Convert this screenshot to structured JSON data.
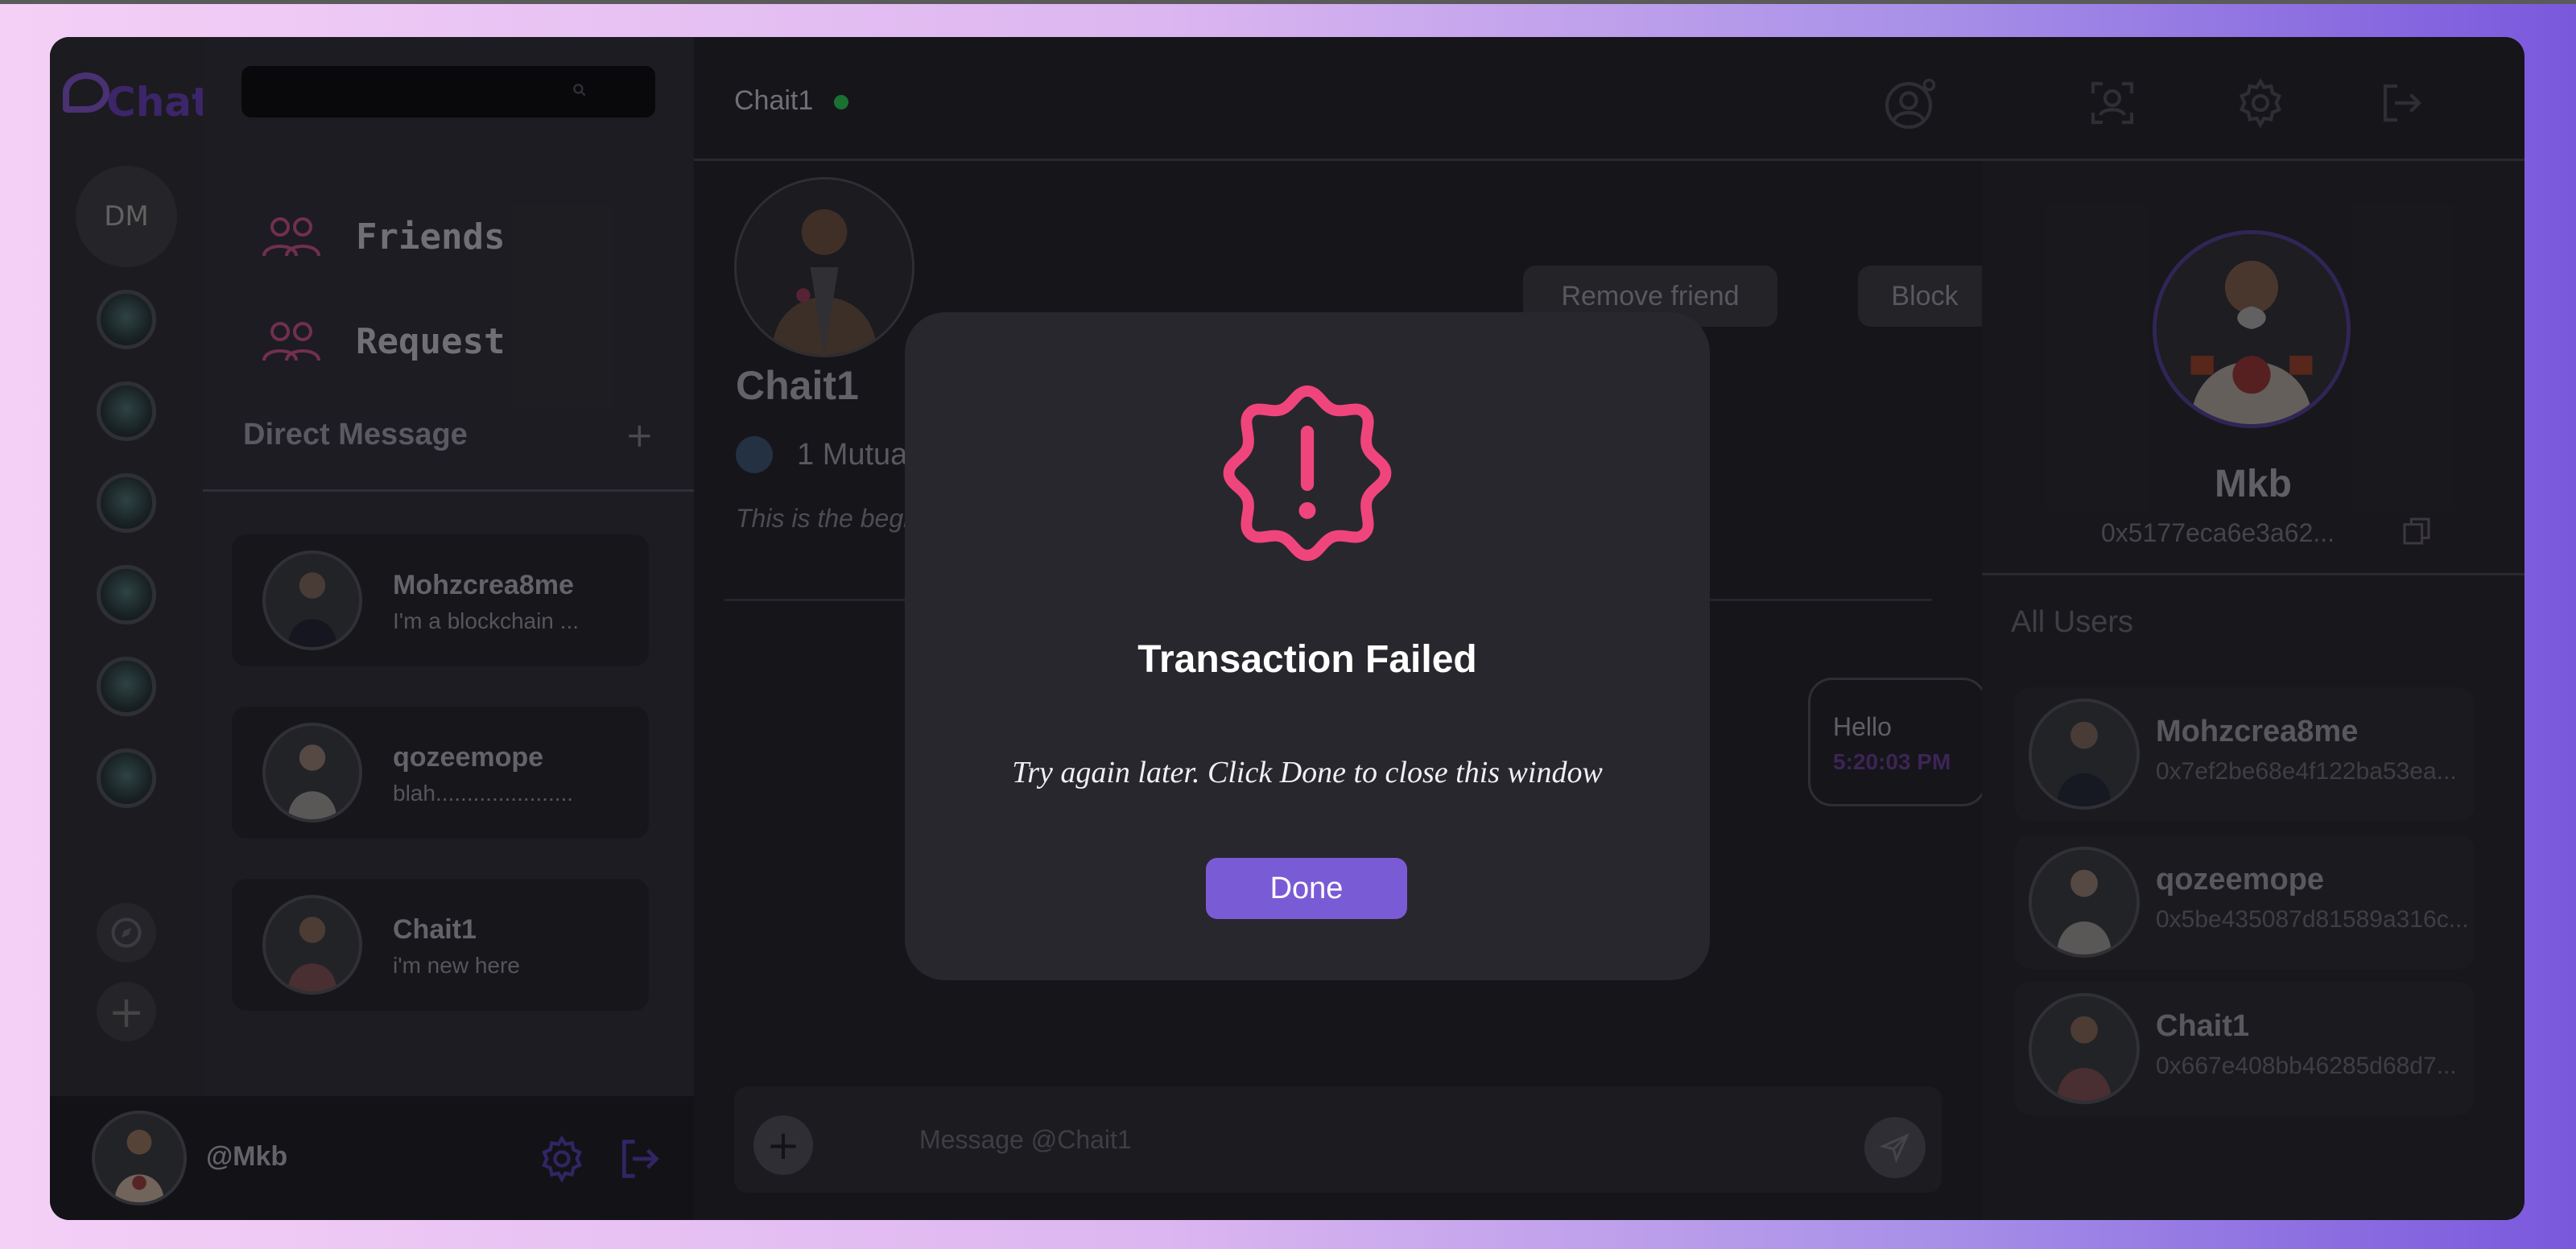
{
  "app": {
    "logo_text": "Chat"
  },
  "rail": {
    "dm_label": "DM"
  },
  "sidebar": {
    "search_placeholder": "",
    "nav": [
      {
        "label": "Friends"
      },
      {
        "label": "Request"
      }
    ],
    "direct_message_heading": "Direct Message",
    "add_symbol": "+",
    "dms": [
      {
        "name": "Mohzcrea8me",
        "preview": "I'm a blockchain ..."
      },
      {
        "name": "qozeemope",
        "preview": "blah......................"
      },
      {
        "name": "Chait1",
        "preview": "i'm new here"
      }
    ],
    "current_user": {
      "name": "@Mkb"
    }
  },
  "chat": {
    "title": "Chait1",
    "profile_name": "Chait1",
    "mutual": "1 Mutua",
    "beginning_text": "This is the begi",
    "remove_friend_label": "Remove friend",
    "block_label": "Block",
    "message": {
      "text": "Hello",
      "time": "5:20:03 PM"
    },
    "composer_placeholder": "Message @Chait1",
    "add_symbol": "+"
  },
  "profile": {
    "name": "Mkb",
    "address": "0x5177eca6e3a62..."
  },
  "all_users": {
    "heading": "All Users",
    "users": [
      {
        "name": "Mohzcrea8me",
        "address": "0x7ef2be68e4f122ba53ea..."
      },
      {
        "name": "qozeemope",
        "address": "0x5be435087d81589a316c..."
      },
      {
        "name": "Chait1",
        "address": "0x667e408bb46285d68d7..."
      }
    ]
  },
  "modal": {
    "title": "Transaction Failed",
    "message": "Try again later. Click Done to close this window",
    "done_label": "Done",
    "icon": "alert-badge-icon",
    "accent": "#f0457c",
    "button_color": "#7a5bd6"
  }
}
